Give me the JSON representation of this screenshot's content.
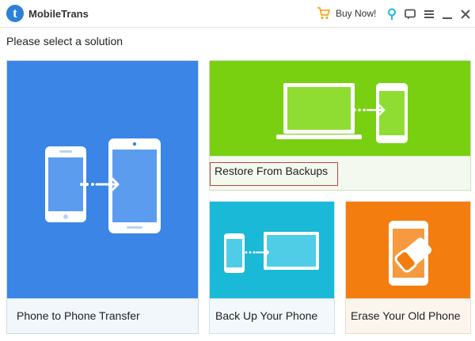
{
  "app": {
    "title": "MobileTrans",
    "logo_letter": "t",
    "buy_label": "Buy Now!"
  },
  "prompt": "Please select a solution",
  "tiles": {
    "phone_to_phone": {
      "label": "Phone to Phone Transfer",
      "color": "#3a85e6"
    },
    "restore": {
      "label": "Restore From Backups",
      "color": "#79d011"
    },
    "backup": {
      "label": "Back Up Your Phone",
      "color": "#1ab9d7"
    },
    "erase": {
      "label": "Erase Your Old Phone",
      "color": "#f47d10"
    }
  },
  "icons": [
    "cart-icon",
    "location-pin-icon",
    "feedback-icon",
    "menu-icon",
    "minimize-icon",
    "close-icon"
  ],
  "colors": {
    "cart": "#f5a623",
    "pin": "#1ab9d7",
    "accent": "#2f7fd8",
    "selection_border": "#b44848"
  }
}
